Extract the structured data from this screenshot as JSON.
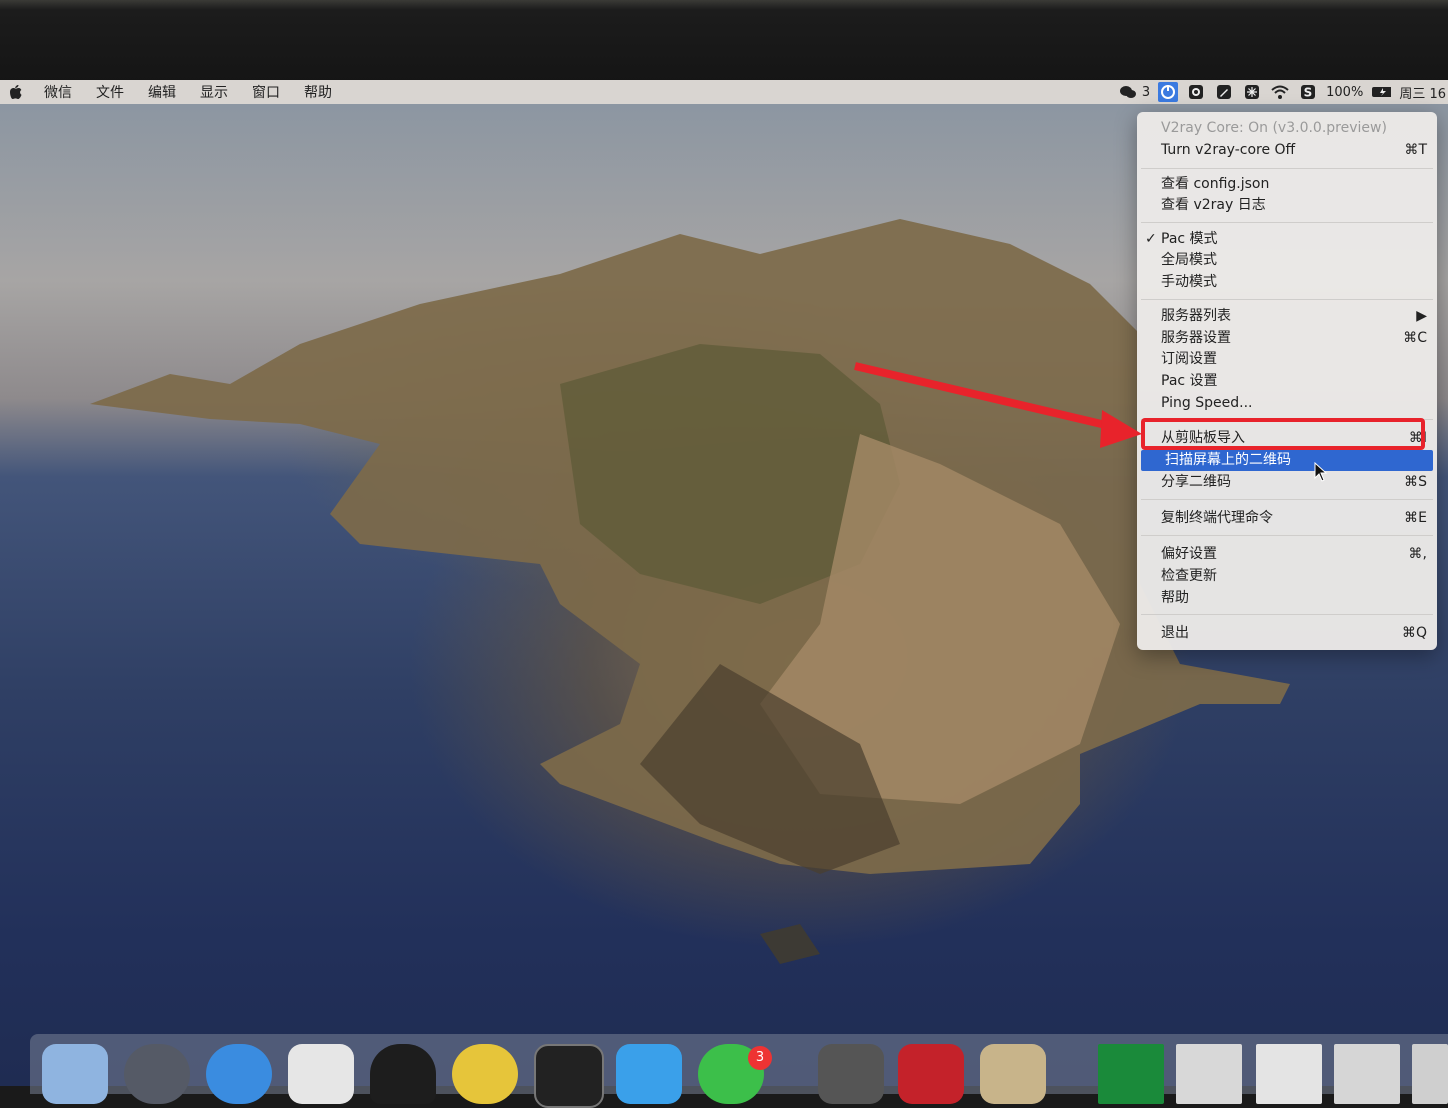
{
  "menubar": {
    "items": [
      "微信",
      "文件",
      "编辑",
      "显示",
      "窗口",
      "帮助"
    ],
    "wechat_count": "3",
    "battery": "100%",
    "clock": "周三 16"
  },
  "menu": {
    "core_status": "V2ray Core: On  (v3.0.0.preview)",
    "turn_off": {
      "label": "Turn v2ray-core Off",
      "shortcut": "⌘T"
    },
    "view_config": "查看 config.json",
    "view_log": "查看 v2ray 日志",
    "pac_mode": "Pac 模式",
    "global_mode": "全局模式",
    "manual_mode": "手动模式",
    "server_list": {
      "label": "服务器列表",
      "shortcut": "▶"
    },
    "server_settings": {
      "label": "服务器设置",
      "shortcut": "⌘C"
    },
    "subscription": "订阅设置",
    "pac_settings": "Pac 设置",
    "ping_speed": "Ping Speed...",
    "import_clipboard": {
      "label": "从剪贴板导入",
      "shortcut": "⌘I"
    },
    "scan_qr": "扫描屏幕上的二维码",
    "share_qr": {
      "label": "分享二维码",
      "shortcut": "⌘S"
    },
    "copy_proxy_cmd": {
      "label": "复制终端代理命令",
      "shortcut": "⌘E"
    },
    "preferences": {
      "label": "偏好设置",
      "shortcut": "⌘,"
    },
    "check_update": "检查更新",
    "help": "帮助",
    "quit": {
      "label": "退出",
      "shortcut": "⌘Q"
    }
  },
  "dock": {
    "wechat_badge": "3",
    "icons": [
      "finder-icon",
      "launchpad-icon",
      "safari-icon",
      "chrome-icon",
      "qq-icon",
      "maps-icon",
      "terminal-icon",
      "xcode-icon",
      "wechat-icon",
      "sublime-icon",
      "filezilla-icon",
      "preview-icon",
      "activity-icon",
      "window-icon",
      "window-icon",
      "window-icon",
      "window-icon"
    ]
  },
  "colors": {
    "highlight": "#2f67d0",
    "annotation": "#e8232b"
  }
}
